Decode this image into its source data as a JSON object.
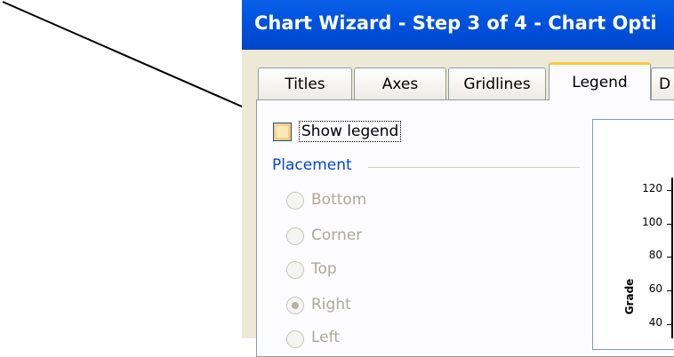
{
  "window": {
    "title": "Chart Wizard - Step 3 of 4 - Chart Opti"
  },
  "tabs": [
    {
      "label": "Titles"
    },
    {
      "label": "Axes"
    },
    {
      "label": "Gridlines"
    },
    {
      "label": "Legend",
      "active": true
    },
    {
      "label": "D"
    }
  ],
  "legend_options": {
    "show_legend_label": "Show legend",
    "show_legend_checked": false,
    "placement_group_label": "Placement",
    "placement_options": [
      {
        "label": "Bottom",
        "selected": false,
        "enabled": false
      },
      {
        "label": "Corner",
        "selected": false,
        "enabled": false
      },
      {
        "label": "Top",
        "selected": false,
        "enabled": false
      },
      {
        "label": "Right",
        "selected": true,
        "enabled": false
      },
      {
        "label": "Left",
        "selected": false,
        "enabled": false
      }
    ]
  },
  "preview_chart": {
    "ylabel": "Grade",
    "yticks": [
      "120",
      "100",
      "80",
      "60",
      "40"
    ]
  },
  "colors": {
    "titlebar": "#0053E0",
    "dialog_face": "#ECE9D8",
    "active_tab_highlight": "#FFC83C",
    "group_label": "#0046D5",
    "disabled_text": "#ACA899"
  },
  "icons": {
    "annotation": "arrow-pointer-icon"
  }
}
